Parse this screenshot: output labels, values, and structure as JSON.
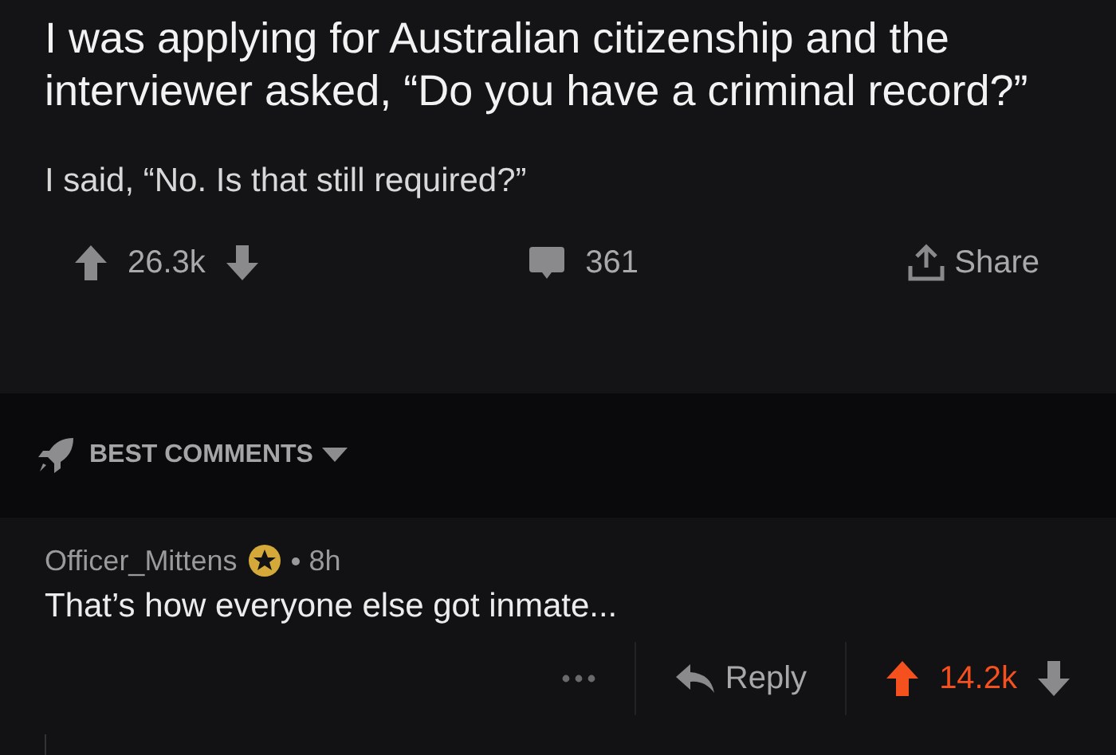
{
  "post": {
    "title": "I was applying for Australian citizenship and the interviewer asked, “Do you have a criminal record?”",
    "body": "I said, “No. Is that still required?”",
    "score": "26.3k",
    "upvoted": false,
    "comments": "361",
    "share": "Share"
  },
  "sort": {
    "label": "BEST COMMENTS"
  },
  "comments": [
    {
      "author": "Officer_Mittens",
      "badge": true,
      "time": "8h",
      "text": "That’s how everyone else got inmate...",
      "reply": "Reply",
      "score": "14.2k",
      "upvoted": true
    }
  ]
}
